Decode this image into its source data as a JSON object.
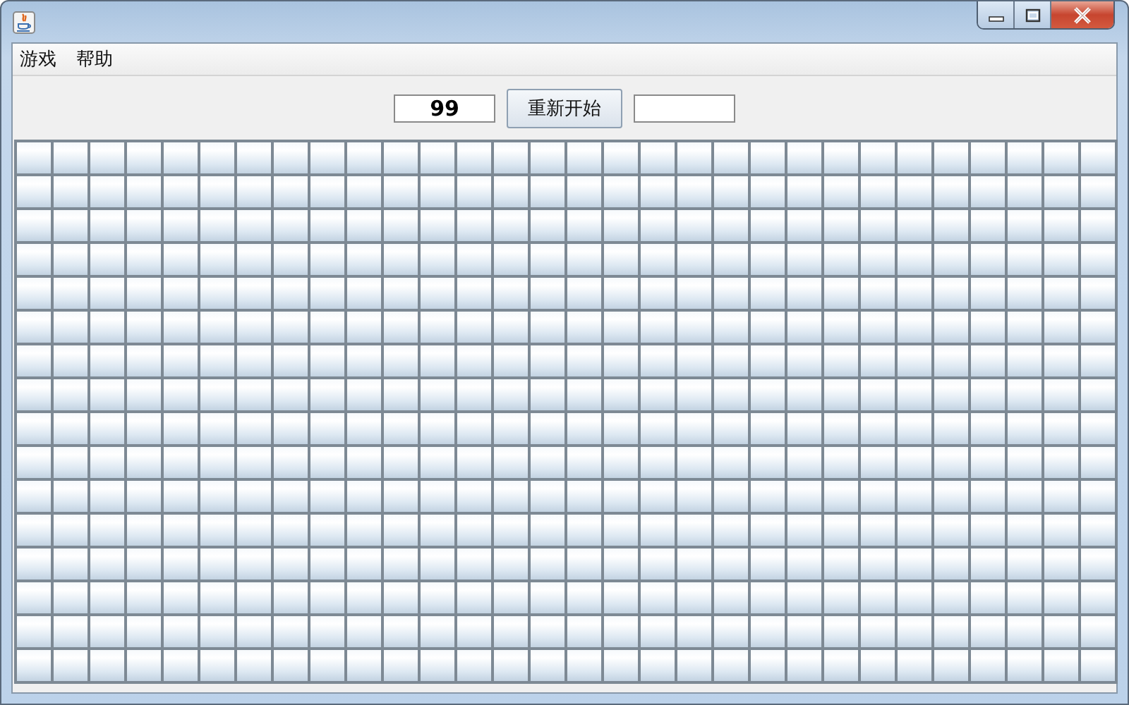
{
  "menu": [
    {
      "label": "游戏"
    },
    {
      "label": "帮助"
    }
  ],
  "toolbar": {
    "mine_counter": "99",
    "restart_button": "重新开始"
  },
  "board": {
    "rows": [
      [
        {
          "revealed": false
        },
        {
          "revealed": false
        },
        {
          "revealed": false
        },
        {
          "revealed": false
        },
        {
          "revealed": false
        },
        {
          "revealed": false
        },
        {
          "revealed": false
        },
        {
          "revealed": false
        },
        {
          "revealed": false
        },
        {
          "revealed": false
        },
        {
          "revealed": false
        },
        {
          "revealed": false
        },
        {
          "revealed": false
        },
        {
          "revealed": false
        },
        {
          "revealed": false
        },
        {
          "revealed": false
        },
        {
          "revealed": false
        },
        {
          "revealed": false
        },
        {
          "revealed": false
        },
        {
          "revealed": false
        },
        {
          "revealed": false
        },
        {
          "revealed": false
        },
        {
          "revealed": false
        },
        {
          "revealed": false
        },
        {
          "revealed": false
        },
        {
          "revealed": false
        },
        {
          "revealed": false
        },
        {
          "revealed": false
        },
        {
          "revealed": false
        },
        {
          "revealed": false
        }
      ],
      [
        {
          "revealed": false
        },
        {
          "revealed": false
        },
        {
          "revealed": false
        },
        {
          "revealed": false
        },
        {
          "revealed": false
        },
        {
          "revealed": false
        },
        {
          "revealed": false
        },
        {
          "revealed": false
        },
        {
          "revealed": false
        },
        {
          "revealed": false
        },
        {
          "revealed": false
        },
        {
          "revealed": false
        },
        {
          "revealed": false
        },
        {
          "revealed": false
        },
        {
          "revealed": false
        },
        {
          "revealed": false
        },
        {
          "revealed": false
        },
        {
          "revealed": false
        },
        {
          "revealed": false
        },
        {
          "revealed": false
        },
        {
          "revealed": false
        },
        {
          "revealed": false
        },
        {
          "revealed": false
        },
        {
          "revealed": false
        },
        {
          "revealed": false
        },
        {
          "revealed": false
        },
        {
          "revealed": false
        },
        {
          "revealed": false
        },
        {
          "revealed": false
        },
        {
          "revealed": false
        }
      ],
      [
        {
          "revealed": false
        },
        {
          "revealed": false
        },
        {
          "revealed": false
        },
        {
          "revealed": false
        },
        {
          "revealed": false
        },
        {
          "revealed": false
        },
        {
          "revealed": false
        },
        {
          "revealed": false
        },
        {
          "revealed": false
        },
        {
          "revealed": false
        },
        {
          "revealed": false
        },
        {
          "revealed": false
        },
        {
          "revealed": false
        },
        {
          "revealed": false
        },
        {
          "revealed": false
        },
        {
          "revealed": false
        },
        {
          "revealed": false
        },
        {
          "revealed": false
        },
        {
          "revealed": false
        },
        {
          "revealed": false
        },
        {
          "revealed": false
        },
        {
          "revealed": false
        },
        {
          "revealed": false
        },
        {
          "revealed": false
        },
        {
          "revealed": false
        },
        {
          "revealed": false
        },
        {
          "revealed": false
        },
        {
          "revealed": false
        },
        {
          "revealed": false
        },
        {
          "revealed": false
        }
      ],
      [
        {
          "revealed": false
        },
        {
          "revealed": false
        },
        {
          "revealed": false
        },
        {
          "revealed": false
        },
        {
          "revealed": false
        },
        {
          "revealed": false
        },
        {
          "revealed": false
        },
        {
          "revealed": false
        },
        {
          "revealed": false
        },
        {
          "revealed": false
        },
        {
          "revealed": false
        },
        {
          "revealed": false
        },
        {
          "revealed": false
        },
        {
          "revealed": false
        },
        {
          "revealed": false
        },
        {
          "revealed": false
        },
        {
          "revealed": false
        },
        {
          "revealed": false
        },
        {
          "revealed": false
        },
        {
          "revealed": false
        },
        {
          "revealed": false
        },
        {
          "revealed": false
        },
        {
          "revealed": false
        },
        {
          "revealed": false
        },
        {
          "revealed": false
        },
        {
          "revealed": false
        },
        {
          "revealed": false
        },
        {
          "revealed": false
        },
        {
          "revealed": false
        },
        {
          "revealed": false
        }
      ],
      [
        {
          "revealed": false
        },
        {
          "revealed": false
        },
        {
          "revealed": false
        },
        {
          "revealed": false
        },
        {
          "revealed": false
        },
        {
          "revealed": false
        },
        {
          "revealed": false
        },
        {
          "revealed": false
        },
        {
          "revealed": false
        },
        {
          "revealed": false
        },
        {
          "revealed": false
        },
        {
          "revealed": false
        },
        {
          "revealed": false
        },
        {
          "revealed": false
        },
        {
          "revealed": false
        },
        {
          "revealed": false
        },
        {
          "revealed": false
        },
        {
          "revealed": false
        },
        {
          "revealed": false
        },
        {
          "revealed": false
        },
        {
          "revealed": false
        },
        {
          "revealed": false
        },
        {
          "revealed": false
        },
        {
          "revealed": false
        },
        {
          "revealed": false
        },
        {
          "revealed": false
        },
        {
          "revealed": false
        },
        {
          "revealed": false
        },
        {
          "revealed": false
        },
        {
          "revealed": false
        }
      ],
      [
        {
          "revealed": false
        },
        {
          "revealed": false
        },
        {
          "revealed": false
        },
        {
          "revealed": false
        },
        {
          "revealed": false
        },
        {
          "revealed": false
        },
        {
          "revealed": false
        },
        {
          "revealed": false
        },
        {
          "revealed": false
        },
        {
          "revealed": false
        },
        {
          "revealed": false
        },
        {
          "revealed": false
        },
        {
          "revealed": false
        },
        {
          "revealed": false
        },
        {
          "revealed": false
        },
        {
          "revealed": false
        },
        {
          "revealed": false
        },
        {
          "revealed": false
        },
        {
          "revealed": false
        },
        {
          "revealed": false
        },
        {
          "revealed": false
        },
        {
          "revealed": false
        },
        {
          "revealed": false
        },
        {
          "revealed": false
        },
        {
          "revealed": false
        },
        {
          "revealed": false
        },
        {
          "revealed": false
        },
        {
          "revealed": false
        },
        {
          "revealed": false
        },
        {
          "revealed": false
        }
      ],
      [
        {
          "revealed": false
        },
        {
          "revealed": false
        },
        {
          "revealed": false
        },
        {
          "revealed": false
        },
        {
          "revealed": false
        },
        {
          "revealed": false
        },
        {
          "revealed": false
        },
        {
          "revealed": false
        },
        {
          "revealed": false
        },
        {
          "revealed": false
        },
        {
          "revealed": false
        },
        {
          "revealed": false
        },
        {
          "revealed": false
        },
        {
          "revealed": false
        },
        {
          "revealed": false
        },
        {
          "revealed": false
        },
        {
          "revealed": false
        },
        {
          "revealed": false
        },
        {
          "revealed": false
        },
        {
          "revealed": false
        },
        {
          "revealed": false
        },
        {
          "revealed": false
        },
        {
          "revealed": false
        },
        {
          "revealed": false
        },
        {
          "revealed": false
        },
        {
          "revealed": false
        },
        {
          "revealed": false
        },
        {
          "revealed": false
        },
        {
          "revealed": false
        },
        {
          "revealed": false
        }
      ],
      [
        {
          "revealed": false
        },
        {
          "revealed": false
        },
        {
          "revealed": false
        },
        {
          "revealed": false
        },
        {
          "revealed": false
        },
        {
          "revealed": false
        },
        {
          "revealed": false
        },
        {
          "revealed": false
        },
        {
          "revealed": false
        },
        {
          "revealed": false
        },
        {
          "revealed": false
        },
        {
          "revealed": false
        },
        {
          "revealed": false
        },
        {
          "revealed": false
        },
        {
          "revealed": false
        },
        {
          "revealed": false
        },
        {
          "revealed": false
        },
        {
          "revealed": false
        },
        {
          "revealed": false
        },
        {
          "revealed": false
        },
        {
          "revealed": false
        },
        {
          "revealed": false
        },
        {
          "revealed": false
        },
        {
          "revealed": false
        },
        {
          "revealed": false
        },
        {
          "revealed": false
        },
        {
          "revealed": false
        },
        {
          "revealed": false
        },
        {
          "revealed": false
        },
        {
          "revealed": false
        }
      ],
      [
        {
          "revealed": false
        },
        {
          "revealed": false
        },
        {
          "revealed": false
        },
        {
          "revealed": false
        },
        {
          "revealed": false
        },
        {
          "revealed": false
        },
        {
          "revealed": false
        },
        {
          "revealed": false
        },
        {
          "revealed": false
        },
        {
          "revealed": false
        },
        {
          "revealed": false
        },
        {
          "revealed": false
        },
        {
          "revealed": false
        },
        {
          "revealed": false
        },
        {
          "revealed": false
        },
        {
          "revealed": false
        },
        {
          "revealed": false
        },
        {
          "revealed": false
        },
        {
          "revealed": false
        },
        {
          "revealed": false
        },
        {
          "revealed": false
        },
        {
          "revealed": false
        },
        {
          "revealed": false
        },
        {
          "revealed": false
        },
        {
          "revealed": false
        },
        {
          "revealed": false
        },
        {
          "revealed": false
        },
        {
          "revealed": false
        },
        {
          "revealed": false
        },
        {
          "revealed": false
        }
      ],
      [
        {
          "revealed": false
        },
        {
          "revealed": false
        },
        {
          "revealed": false
        },
        {
          "revealed": false
        },
        {
          "revealed": false
        },
        {
          "revealed": false
        },
        {
          "revealed": false
        },
        {
          "revealed": false
        },
        {
          "revealed": false
        },
        {
          "revealed": false
        },
        {
          "revealed": false
        },
        {
          "revealed": false
        },
        {
          "revealed": false
        },
        {
          "revealed": false
        },
        {
          "revealed": false
        },
        {
          "revealed": false
        },
        {
          "revealed": false
        },
        {
          "revealed": false
        },
        {
          "revealed": false
        },
        {
          "revealed": false
        },
        {
          "revealed": false
        },
        {
          "revealed": false
        },
        {
          "revealed": false
        },
        {
          "revealed": false
        },
        {
          "revealed": false
        },
        {
          "revealed": false
        },
        {
          "revealed": false
        },
        {
          "revealed": false
        },
        {
          "revealed": false
        },
        {
          "revealed": false
        }
      ],
      [
        {
          "revealed": false
        },
        {
          "revealed": false
        },
        {
          "revealed": false
        },
        {
          "revealed": false
        },
        {
          "revealed": false
        },
        {
          "revealed": false
        },
        {
          "revealed": false
        },
        {
          "revealed": false
        },
        {
          "revealed": false
        },
        {
          "revealed": false
        },
        {
          "revealed": false
        },
        {
          "revealed": false
        },
        {
          "revealed": false
        },
        {
          "revealed": false
        },
        {
          "revealed": false
        },
        {
          "revealed": false
        },
        {
          "revealed": false
        },
        {
          "revealed": false
        },
        {
          "revealed": false
        },
        {
          "revealed": false
        },
        {
          "revealed": false
        },
        {
          "revealed": false
        },
        {
          "revealed": false
        },
        {
          "revealed": false
        },
        {
          "revealed": false
        },
        {
          "revealed": false
        },
        {
          "revealed": false
        },
        {
          "revealed": false
        },
        {
          "revealed": false
        },
        {
          "revealed": false
        }
      ],
      [
        {
          "revealed": false
        },
        {
          "revealed": false
        },
        {
          "revealed": false
        },
        {
          "revealed": false
        },
        {
          "revealed": false
        },
        {
          "revealed": false
        },
        {
          "revealed": false
        },
        {
          "revealed": false
        },
        {
          "revealed": false
        },
        {
          "revealed": false
        },
        {
          "revealed": false
        },
        {
          "revealed": false
        },
        {
          "revealed": false
        },
        {
          "revealed": false
        },
        {
          "revealed": false
        },
        {
          "revealed": false
        },
        {
          "revealed": false
        },
        {
          "revealed": false
        },
        {
          "revealed": false
        },
        {
          "revealed": false
        },
        {
          "revealed": false
        },
        {
          "revealed": false
        },
        {
          "revealed": false
        },
        {
          "revealed": false
        },
        {
          "revealed": false
        },
        {
          "revealed": false
        },
        {
          "revealed": false
        },
        {
          "revealed": false
        },
        {
          "revealed": false
        },
        {
          "revealed": false
        }
      ],
      [
        {
          "revealed": false
        },
        {
          "revealed": false
        },
        {
          "revealed": false
        },
        {
          "revealed": false
        },
        {
          "revealed": false
        },
        {
          "revealed": false
        },
        {
          "revealed": false
        },
        {
          "revealed": false
        },
        {
          "revealed": false
        },
        {
          "revealed": false
        },
        {
          "revealed": false
        },
        {
          "revealed": false
        },
        {
          "revealed": false
        },
        {
          "revealed": false
        },
        {
          "revealed": false
        },
        {
          "revealed": false
        },
        {
          "revealed": false
        },
        {
          "revealed": false
        },
        {
          "revealed": false
        },
        {
          "revealed": false
        },
        {
          "revealed": false
        },
        {
          "revealed": false
        },
        {
          "revealed": false
        },
        {
          "revealed": false
        },
        {
          "revealed": false
        },
        {
          "revealed": false
        },
        {
          "revealed": false
        },
        {
          "revealed": false
        },
        {
          "revealed": false
        },
        {
          "revealed": false
        }
      ],
      [
        {
          "revealed": false
        },
        {
          "revealed": false
        },
        {
          "revealed": false
        },
        {
          "revealed": false
        },
        {
          "revealed": false
        },
        {
          "revealed": false
        },
        {
          "revealed": false
        },
        {
          "revealed": false
        },
        {
          "revealed": false
        },
        {
          "revealed": false
        },
        {
          "revealed": false
        },
        {
          "revealed": false
        },
        {
          "revealed": false
        },
        {
          "revealed": false
        },
        {
          "revealed": false
        },
        {
          "revealed": false
        },
        {
          "revealed": false
        },
        {
          "revealed": false
        },
        {
          "revealed": false
        },
        {
          "revealed": false
        },
        {
          "revealed": false
        },
        {
          "revealed": false
        },
        {
          "revealed": false
        },
        {
          "revealed": false
        },
        {
          "revealed": false
        },
        {
          "revealed": false
        },
        {
          "revealed": false
        },
        {
          "revealed": false
        },
        {
          "revealed": false
        },
        {
          "revealed": false
        }
      ],
      [
        {
          "revealed": false
        },
        {
          "revealed": false
        },
        {
          "revealed": false
        },
        {
          "revealed": false
        },
        {
          "revealed": false
        },
        {
          "revealed": false
        },
        {
          "revealed": false
        },
        {
          "revealed": false
        },
        {
          "revealed": false
        },
        {
          "revealed": false
        },
        {
          "revealed": false
        },
        {
          "revealed": false
        },
        {
          "revealed": false
        },
        {
          "revealed": false
        },
        {
          "revealed": false
        },
        {
          "revealed": false
        },
        {
          "revealed": false
        },
        {
          "revealed": false
        },
        {
          "revealed": false
        },
        {
          "revealed": false
        },
        {
          "revealed": false
        },
        {
          "revealed": false
        },
        {
          "revealed": false
        },
        {
          "revealed": false
        },
        {
          "revealed": false
        },
        {
          "revealed": false
        },
        {
          "revealed": false
        },
        {
          "revealed": false
        },
        {
          "revealed": false
        },
        {
          "revealed": false
        }
      ],
      [
        {
          "revealed": false
        },
        {
          "revealed": false
        },
        {
          "revealed": false
        },
        {
          "revealed": false
        },
        {
          "revealed": false
        },
        {
          "revealed": false
        },
        {
          "revealed": false
        },
        {
          "revealed": false
        },
        {
          "revealed": false
        },
        {
          "revealed": false
        },
        {
          "revealed": false
        },
        {
          "revealed": false
        },
        {
          "revealed": false
        },
        {
          "revealed": false
        },
        {
          "revealed": false
        },
        {
          "revealed": false
        },
        {
          "revealed": false
        },
        {
          "revealed": false
        },
        {
          "revealed": false
        },
        {
          "revealed": false
        },
        {
          "revealed": false
        },
        {
          "revealed": false
        },
        {
          "revealed": false
        },
        {
          "revealed": false
        },
        {
          "revealed": false
        },
        {
          "revealed": false
        },
        {
          "revealed": false
        },
        {
          "revealed": false
        },
        {
          "revealed": false
        },
        {
          "revealed": false
        }
      ]
    ]
  }
}
